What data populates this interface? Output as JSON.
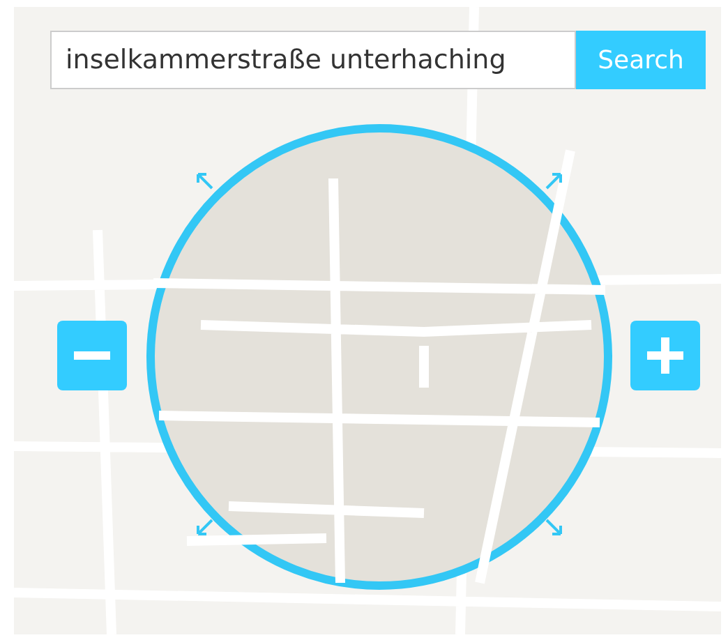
{
  "search": {
    "value": "inselkammerstraße unterhaching",
    "button": "Search"
  }
}
